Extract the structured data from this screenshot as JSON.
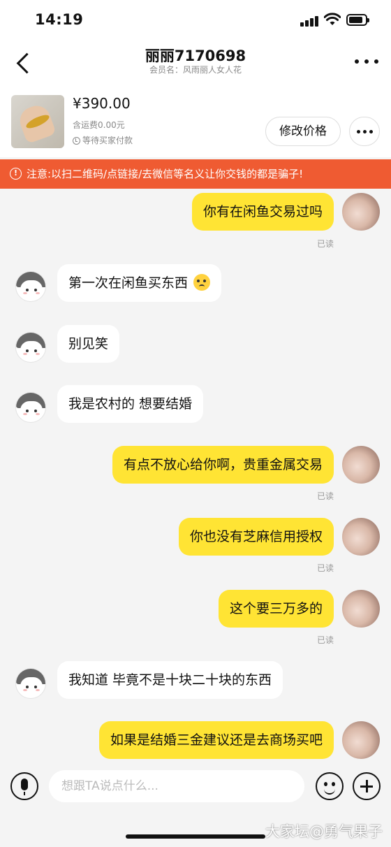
{
  "status": {
    "time": "14:19"
  },
  "nav": {
    "title": "丽丽7170698",
    "subtitle": "会员名：风雨丽人女人花"
  },
  "product": {
    "price": "¥390.00",
    "shipping": "含运费0.00元",
    "status": "等待买家付款",
    "modify_label": "修改价格"
  },
  "warning": {
    "icon": "!",
    "text": "注意:以扫二维码/点链接/去微信等名义让你交钱的都是骗子!"
  },
  "messages": [
    {
      "side": "me",
      "text": "你有在闲鱼交易过吗",
      "read": "已读"
    },
    {
      "side": "other",
      "text": "第一次在闲鱼买东西"
    },
    {
      "side": "other",
      "text": "别见笑"
    },
    {
      "side": "other",
      "text": "我是农村的  想要结婚"
    },
    {
      "side": "me",
      "text": "有点不放心给你啊，贵重金属交易",
      "read": "已读"
    },
    {
      "side": "me",
      "text": "你也没有芝麻信用授权",
      "read": "已读"
    },
    {
      "side": "me",
      "text": "这个要三万多的",
      "read": "已读"
    },
    {
      "side": "other",
      "text": "我知道  毕竟不是十块二十块的东西"
    },
    {
      "side": "me",
      "text": "如果是结婚三金建议还是去商场买吧"
    }
  ],
  "input": {
    "placeholder": "想跟TA说点什么..."
  },
  "watermark": "大家坛@勇气果子",
  "colors": {
    "accent_yellow": "#ffe434",
    "warning_orange": "#ef5b32"
  }
}
